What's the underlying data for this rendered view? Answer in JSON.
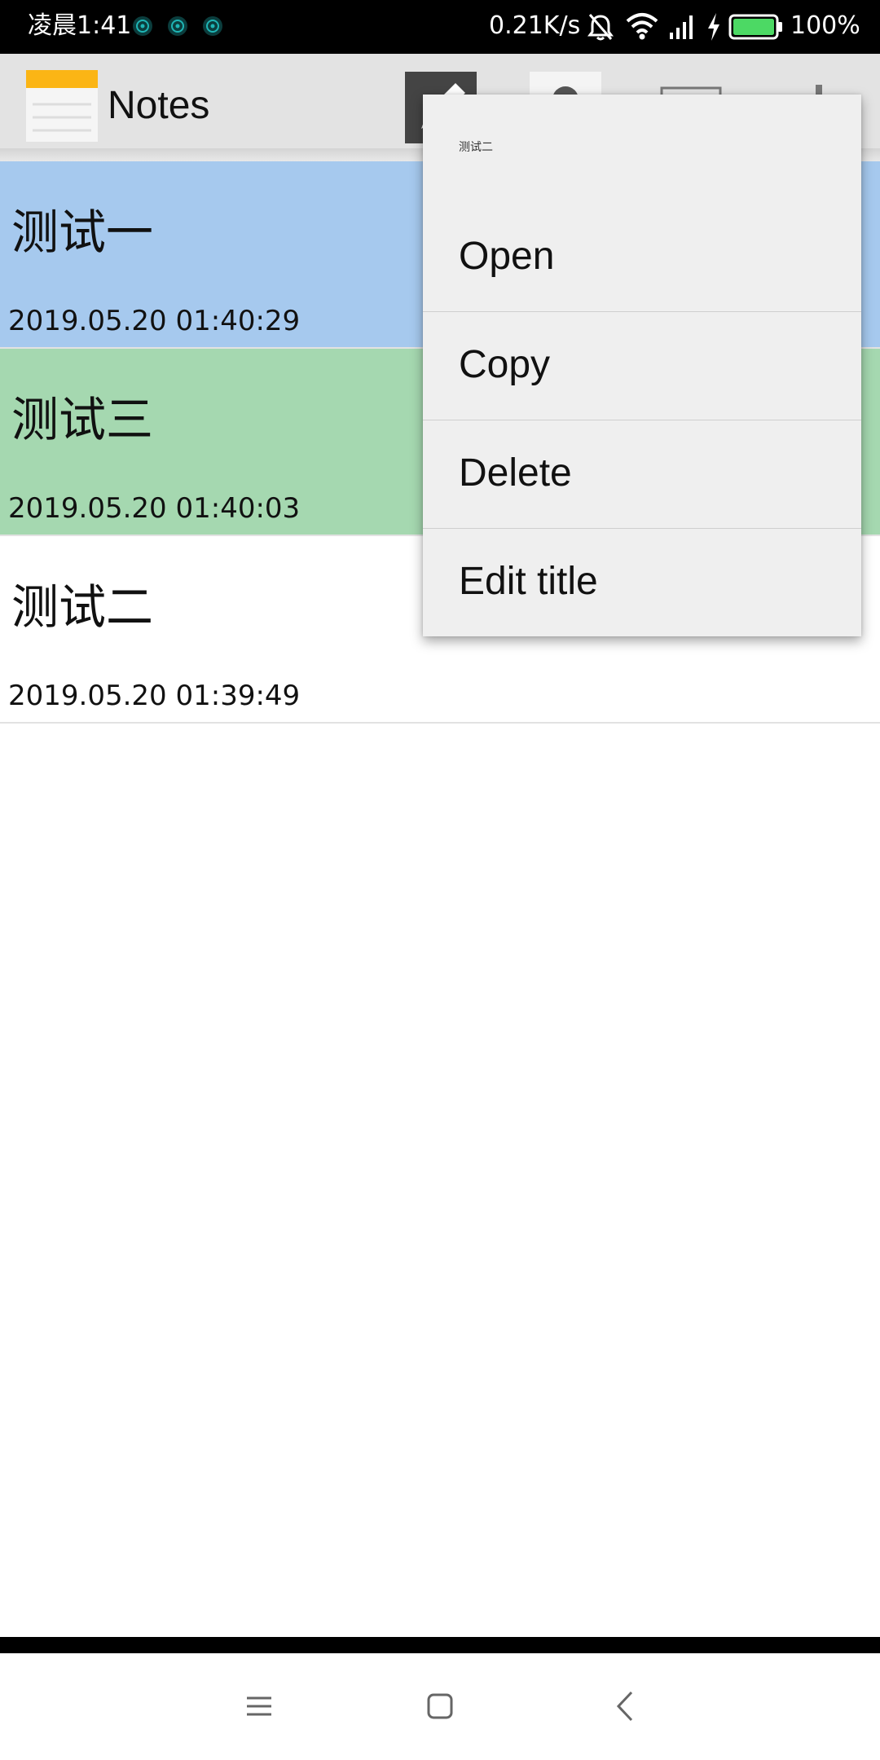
{
  "status_bar": {
    "time": "凌晨1:41",
    "network_speed": "0.21K/s",
    "battery_percent": "100%",
    "battery_level": 1.0,
    "icons": [
      "notification-icon",
      "notification-icon",
      "notification-icon",
      "alarm-off-icon",
      "wifi-icon",
      "signal-icon",
      "charging-icon",
      "battery-icon"
    ],
    "colors": {
      "background": "#000000",
      "battery_fill": "#4cd964"
    }
  },
  "action_bar": {
    "title": "Notes",
    "icons": [
      "notes-logo-icon",
      "new-note-icon",
      "avatar-icon",
      "sort-icon",
      "more-icon"
    ],
    "colors": {
      "background": "#e3e3e3"
    }
  },
  "notes": [
    {
      "title": "测试一",
      "date": "2019.05.20 01:40:29",
      "color": "#a6c9ee"
    },
    {
      "title": "测试三",
      "date": "2019.05.20 01:40:03",
      "color": "#a5d8b0"
    },
    {
      "title": "测试二",
      "date": "2019.05.20 01:39:49",
      "color": "#ffffff"
    }
  ],
  "context_menu": {
    "header": "测试二",
    "items": [
      {
        "label": "Open"
      },
      {
        "label": "Copy"
      },
      {
        "label": "Delete"
      },
      {
        "label": "Edit title"
      }
    ],
    "colors": {
      "background": "#efefef"
    }
  },
  "nav_bar": {
    "icons": [
      "menu-icon",
      "home-icon",
      "back-icon"
    ]
  }
}
